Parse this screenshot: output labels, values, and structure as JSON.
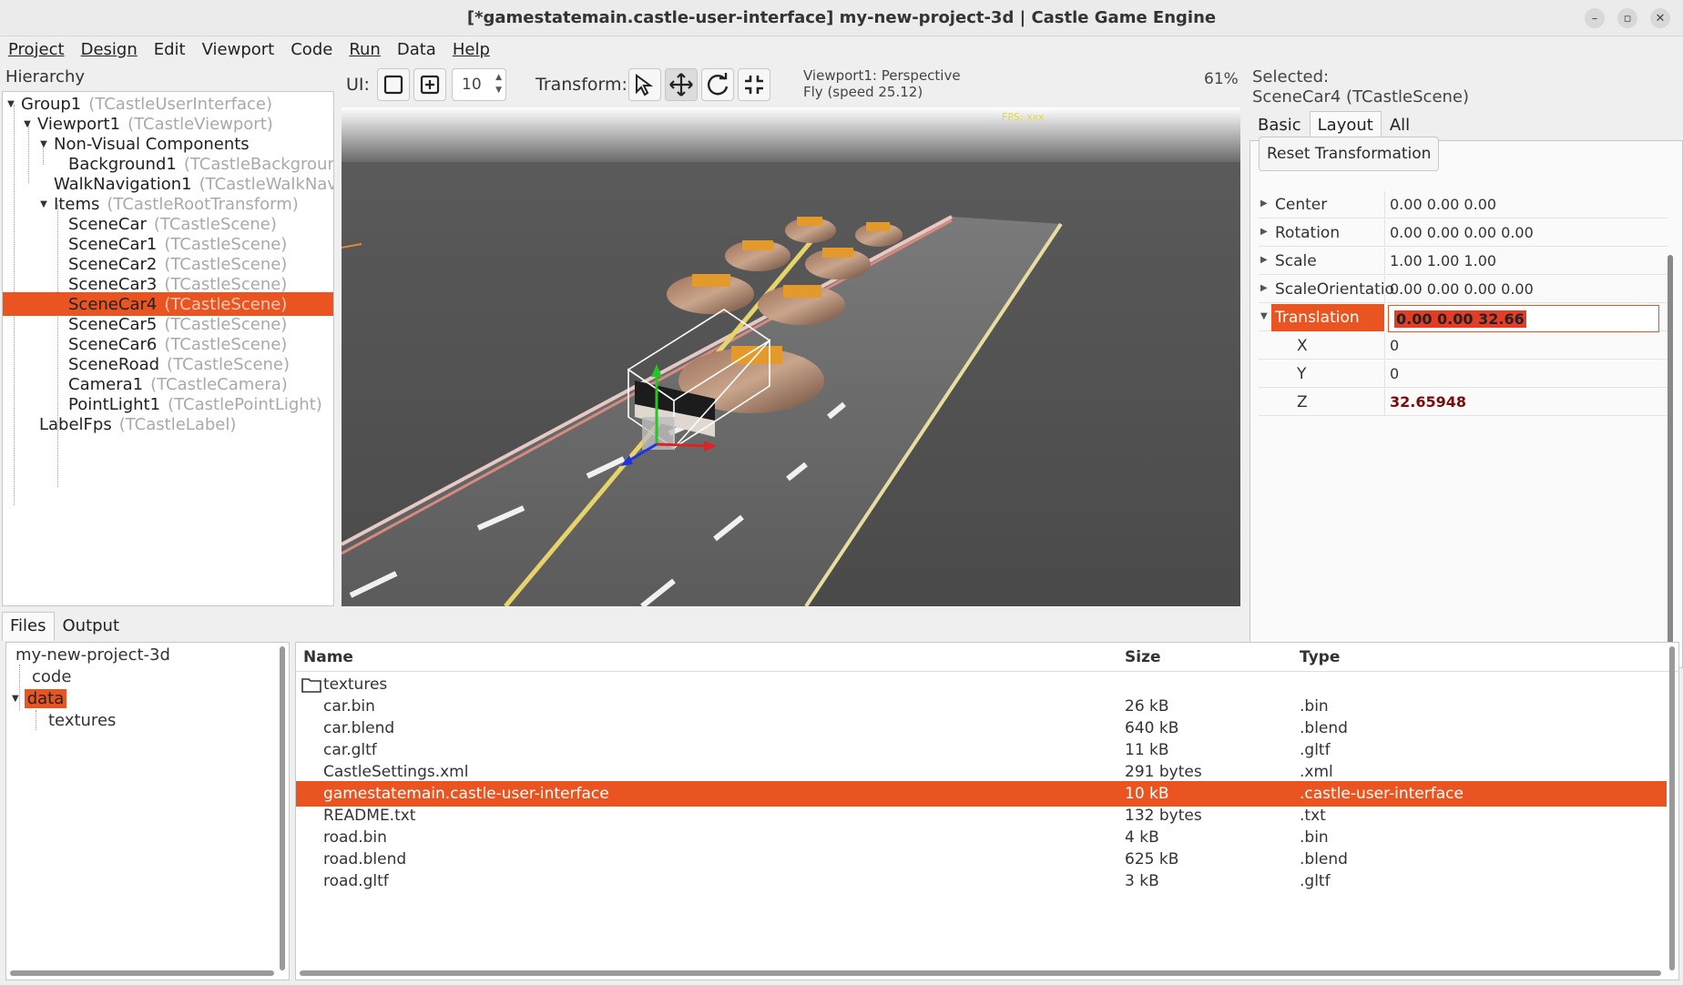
{
  "window": {
    "title": "[*gamestatemain.castle-user-interface] my-new-project-3d | Castle Game Engine"
  },
  "menu": [
    "Project",
    "Design",
    "Edit",
    "Viewport",
    "Code",
    "Run",
    "Data",
    "Help"
  ],
  "hierarchy": {
    "title": "Hierarchy",
    "items": [
      {
        "name": "Group1",
        "cls": "(TCastleUserInterface)"
      },
      {
        "name": "Viewport1",
        "cls": "(TCastleViewport)"
      },
      {
        "name": "Non-Visual Components",
        "cls": ""
      },
      {
        "name": "Background1",
        "cls": "(TCastleBackground"
      },
      {
        "name": "WalkNavigation1",
        "cls": "(TCastleWalkNavig"
      },
      {
        "name": "Items",
        "cls": "(TCastleRootTransform)"
      },
      {
        "name": "SceneCar",
        "cls": "(TCastleScene)"
      },
      {
        "name": "SceneCar1",
        "cls": "(TCastleScene)"
      },
      {
        "name": "SceneCar2",
        "cls": "(TCastleScene)"
      },
      {
        "name": "SceneCar3",
        "cls": "(TCastleScene)"
      },
      {
        "name": "SceneCar4",
        "cls": "(TCastleScene)"
      },
      {
        "name": "SceneCar5",
        "cls": "(TCastleScene)"
      },
      {
        "name": "SceneCar6",
        "cls": "(TCastleScene)"
      },
      {
        "name": "SceneRoad",
        "cls": "(TCastleScene)"
      },
      {
        "name": "Camera1",
        "cls": "(TCastleCamera)"
      },
      {
        "name": "PointLight1",
        "cls": "(TCastlePointLight)"
      },
      {
        "name": "LabelFps",
        "cls": "(TCastleLabel)"
      }
    ]
  },
  "toolbar": {
    "ui_label": "UI:",
    "spin_value": "10",
    "transform_label": "Transform:",
    "viewport_line1": "Viewport1: Perspective",
    "viewport_line2": "Fly (speed 25.12)",
    "zoom": "61%"
  },
  "viewport": {
    "fps_label": "FPS: xxx"
  },
  "inspector": {
    "selected_line1": "Selected:",
    "selected_line2": "SceneCar4 (TCastleScene)",
    "tabs": [
      "Basic",
      "Layout",
      "All"
    ],
    "reset_button": "Reset Transformation",
    "props": [
      {
        "name": "Center",
        "value": "0.00 0.00 0.00"
      },
      {
        "name": "Rotation",
        "value": "0.00 0.00 0.00 0.00"
      },
      {
        "name": "Scale",
        "value": "1.00 1.00 1.00"
      },
      {
        "name": "ScaleOrientatio",
        "value": "0.00 0.00 0.00 0.00"
      },
      {
        "name": "Translation",
        "value": "0.00 0.00 32.66"
      },
      {
        "name": "X",
        "value": "0"
      },
      {
        "name": "Y",
        "value": "0"
      },
      {
        "name": "Z",
        "value": "32.65948"
      }
    ]
  },
  "bottom": {
    "tabs": [
      "Files",
      "Output"
    ],
    "tree": [
      "my-new-project-3d",
      "code",
      "data",
      "textures"
    ],
    "columns": [
      "Name",
      "Size",
      "Type"
    ],
    "files": [
      {
        "name": "textures",
        "size": "",
        "type": ""
      },
      {
        "name": "car.bin",
        "size": "26 kB",
        "type": ".bin"
      },
      {
        "name": "car.blend",
        "size": "640 kB",
        "type": ".blend"
      },
      {
        "name": "car.gltf",
        "size": "11 kB",
        "type": ".gltf"
      },
      {
        "name": "CastleSettings.xml",
        "size": "291 bytes",
        "type": ".xml"
      },
      {
        "name": "gamestatemain.castle-user-interface",
        "size": "10 kB",
        "type": ".castle-user-interface"
      },
      {
        "name": "README.txt",
        "size": "132 bytes",
        "type": ".txt"
      },
      {
        "name": "road.bin",
        "size": "4 kB",
        "type": ".bin"
      },
      {
        "name": "road.blend",
        "size": "625 kB",
        "type": ".blend"
      },
      {
        "name": "road.gltf",
        "size": "3 kB",
        "type": ".gltf"
      }
    ]
  },
  "colors": {
    "accent": "#e95420",
    "sky_top": "#ffffff",
    "ground": "#565656"
  }
}
